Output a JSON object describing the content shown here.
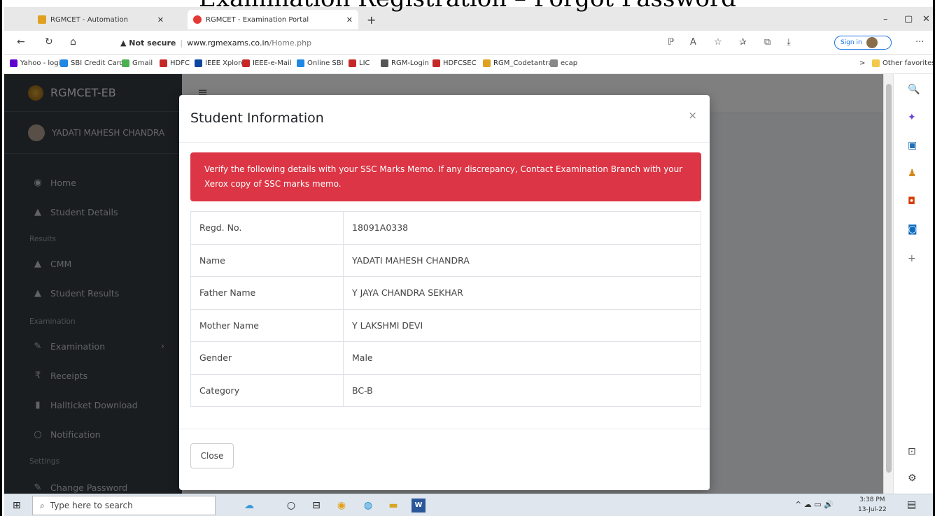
{
  "doc_title": "Examination Registration – Forgot Password",
  "browser": {
    "tabs": [
      {
        "label": "RGMCET - Automation",
        "color": "#e0a020"
      },
      {
        "label": "RGMCET - Examination Portal",
        "color": "#e53935"
      }
    ],
    "new_tab": "+",
    "window_controls": [
      "–",
      "▢",
      "✕"
    ],
    "nav": {
      "back": "←",
      "reload": "↻",
      "home": "⌂"
    },
    "url": {
      "warning": "▲ Not secure",
      "separator": "|",
      "host": "www.rgmexams.co.in",
      "path": "/Home.php"
    },
    "toolbar_icons": [
      "ℙ",
      "A",
      "☆",
      "✰",
      "⧉",
      "⤓"
    ],
    "sign_in": "Sign in",
    "more": "···"
  },
  "favorites": [
    {
      "label": "Yahoo - login",
      "color": "#5f01d1"
    },
    {
      "label": "SBI Credit Card",
      "color": "#1e88e5"
    },
    {
      "label": "Gmail",
      "color": "#4caf50"
    },
    {
      "label": "HDFC",
      "color": "#c62828"
    },
    {
      "label": "IEEE Xplore",
      "color": "#0d47a1"
    },
    {
      "label": "IEEE-e-Mail",
      "color": "#c62828"
    },
    {
      "label": "Online SBI",
      "color": "#1e88e5"
    },
    {
      "label": "LIC",
      "color": "#c62828"
    },
    {
      "label": "RGM-Login",
      "color": "#555555"
    },
    {
      "label": "HDFCSEC",
      "color": "#c62828"
    },
    {
      "label": "RGM_Codetantra",
      "color": "#e0a020"
    },
    {
      "label": "ecap",
      "color": "#888888"
    }
  ],
  "favorites_more": ">",
  "other_favorites": "Other favorites",
  "sidebar": {
    "brand": "RGMCET-EB",
    "user": "YADATI MAHESH CHANDRA",
    "items": [
      {
        "label": "Home",
        "icon": "◉"
      },
      {
        "label": "Student Details",
        "icon": "▲"
      },
      {
        "label": "CMM",
        "icon": "▲"
      },
      {
        "label": "Student Results",
        "icon": "▲"
      },
      {
        "label": "Examination",
        "icon": "✎"
      },
      {
        "label": "Receipts",
        "icon": "₹"
      },
      {
        "label": "Hallticket Download",
        "icon": "▮"
      },
      {
        "label": "Notification",
        "icon": "○"
      },
      {
        "label": "Change Password",
        "icon": "✎"
      }
    ],
    "headers": {
      "results": "Results",
      "examination": "Examination",
      "settings": "Settings"
    },
    "expand": "›"
  },
  "topnav": {
    "menu": "≡"
  },
  "modal": {
    "title": "Student Information",
    "close_x": "×",
    "alert": "Verify the following details with your SSC Marks Memo. If any discrepancy, Contact Examination Branch with your Xerox copy of SSC marks memo.",
    "rows": [
      {
        "label": "Regd. No.",
        "value": "18091A0338"
      },
      {
        "label": "Name",
        "value": "YADATI MAHESH CHANDRA"
      },
      {
        "label": "Father Name",
        "value": "Y JAYA CHANDRA SEKHAR"
      },
      {
        "label": "Mother Name",
        "value": "Y LAKSHMI DEVI"
      },
      {
        "label": "Gender",
        "value": "Male"
      },
      {
        "label": "Category",
        "value": "BC-B"
      }
    ],
    "close_button": "Close"
  },
  "edge_icons": [
    {
      "glyph": "🔍",
      "color": "#1a73e8"
    },
    {
      "glyph": "✦",
      "color": "#6a3fd8"
    },
    {
      "glyph": "▣",
      "color": "#1e6fb8"
    },
    {
      "glyph": "♟",
      "color": "#d48a18"
    },
    {
      "glyph": "◘",
      "color": "#d83b01"
    },
    {
      "glyph": "◙",
      "color": "#0f6cbd"
    },
    {
      "glyph": "+",
      "color": "#777777"
    }
  ],
  "edge_bottom": {
    "split": "⊡",
    "settings": "⚙"
  },
  "taskbar": {
    "start": "⊞",
    "search_placeholder": "Type here to search",
    "search_icon": "⌕",
    "apps": [
      "☁",
      "○",
      "⊟",
      "◉",
      "◍",
      "▬",
      "W"
    ],
    "tray": "^ ☁ ▭ 🔊",
    "time": "3:38 PM",
    "date": "13-Jul-22",
    "notifications": "▤"
  }
}
